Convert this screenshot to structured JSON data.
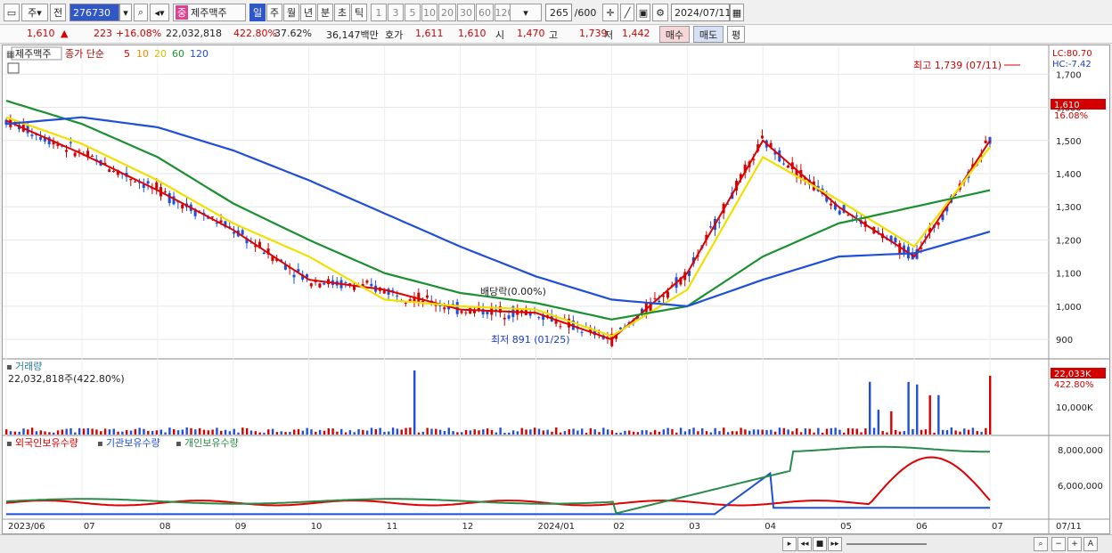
{
  "toolbar": {
    "prefix": "주",
    "prefix2": "전",
    "code": "276730",
    "badge": "중",
    "name": "제주맥주",
    "periods": [
      "일",
      "주",
      "월",
      "년",
      "분",
      "초",
      "틱"
    ],
    "active_period": "일",
    "intervals": [
      "1",
      "3",
      "5",
      "10",
      "20",
      "30",
      "60",
      "120"
    ],
    "count": "265",
    "count_total": "/600",
    "date": "2024/07/11"
  },
  "quote": {
    "price": "1,610",
    "change": "223",
    "change_pct": "+16.08%",
    "volume": "22,032,818",
    "vol_ratio": "422.80%",
    "turnover": "37.62%",
    "amount": "36,147백만",
    "ask_label": "호가",
    "ask1": "1,611",
    "ask2": "1,610",
    "open_label": "시",
    "open": "1,470",
    "high_label": "고",
    "high": "1,739",
    "low_label": "저",
    "low": "1,442",
    "buy": "매수",
    "sell": "매도",
    "eval": "평"
  },
  "price_panel": {
    "stock_label": "제주맥주",
    "ma_title": "종가 단순",
    "ma_periods": [
      "5",
      "10",
      "20",
      "60",
      "120"
    ],
    "ma_colors": [
      "#e00000",
      "#f08800",
      "#f0e000",
      "#1a9030",
      "#1f4fd8"
    ],
    "lc": "LC:80.70",
    "hc": "HC:-7.42",
    "high_annot": "최고 1,739 (07/11)",
    "low_annot": "최저 891 (01/25)",
    "div_annot": "배당락(0.00%)",
    "last_price": "1,610",
    "last_pct": "16.08%",
    "y_ticks": [
      "1,700",
      "1,600",
      "1,500",
      "1,400",
      "1,300",
      "1,200",
      "1,100",
      "1,000",
      "900"
    ]
  },
  "volume_panel": {
    "title": "거래량",
    "value": "22,032,818주(422.80%)",
    "last": "22,033K",
    "last_pct": "422.80%",
    "tick": "10,000K"
  },
  "holdings_panel": {
    "legend": [
      "외국인보유수량",
      "기관보유수량",
      "개인보유수량"
    ],
    "colors": [
      "#e00000",
      "#1f4fd8",
      "#2a8a4a"
    ],
    "ticks": [
      "8,000,000",
      "6,000,000"
    ]
  },
  "x_axis": [
    "2023/06",
    "07",
    "08",
    "09",
    "10",
    "11",
    "12",
    "2024/01",
    "02",
    "03",
    "04",
    "05",
    "06",
    "07"
  ],
  "x_axis_right": "07/11",
  "chart_data": {
    "type": "line",
    "title": "종가 단순 5 10 20 60 120",
    "x": [
      "2023/06",
      "07",
      "08",
      "09",
      "10",
      "11",
      "12",
      "2024/01",
      "02",
      "03",
      "04",
      "05",
      "06",
      "07"
    ],
    "series": [
      {
        "name": "5",
        "values": [
          1560,
          1460,
          1350,
          1230,
          1080,
          1050,
          990,
          980,
          900,
          1100,
          1500,
          1300,
          1150,
          1500
        ]
      },
      {
        "name": "20",
        "values": [
          1570,
          1490,
          1380,
          1250,
          1150,
          1020,
          1000,
          990,
          910,
          1050,
          1450,
          1320,
          1180,
          1480
        ]
      },
      {
        "name": "60",
        "values": [
          1620,
          1550,
          1450,
          1310,
          1200,
          1100,
          1040,
          1010,
          960,
          1000,
          1150,
          1250,
          1300,
          1350
        ]
      },
      {
        "name": "120",
        "values": [
          1550,
          1570,
          1540,
          1470,
          1380,
          1280,
          1180,
          1090,
          1020,
          1000,
          1080,
          1150,
          1160,
          1225
        ]
      }
    ],
    "ylim": [
      860,
      1760
    ]
  }
}
